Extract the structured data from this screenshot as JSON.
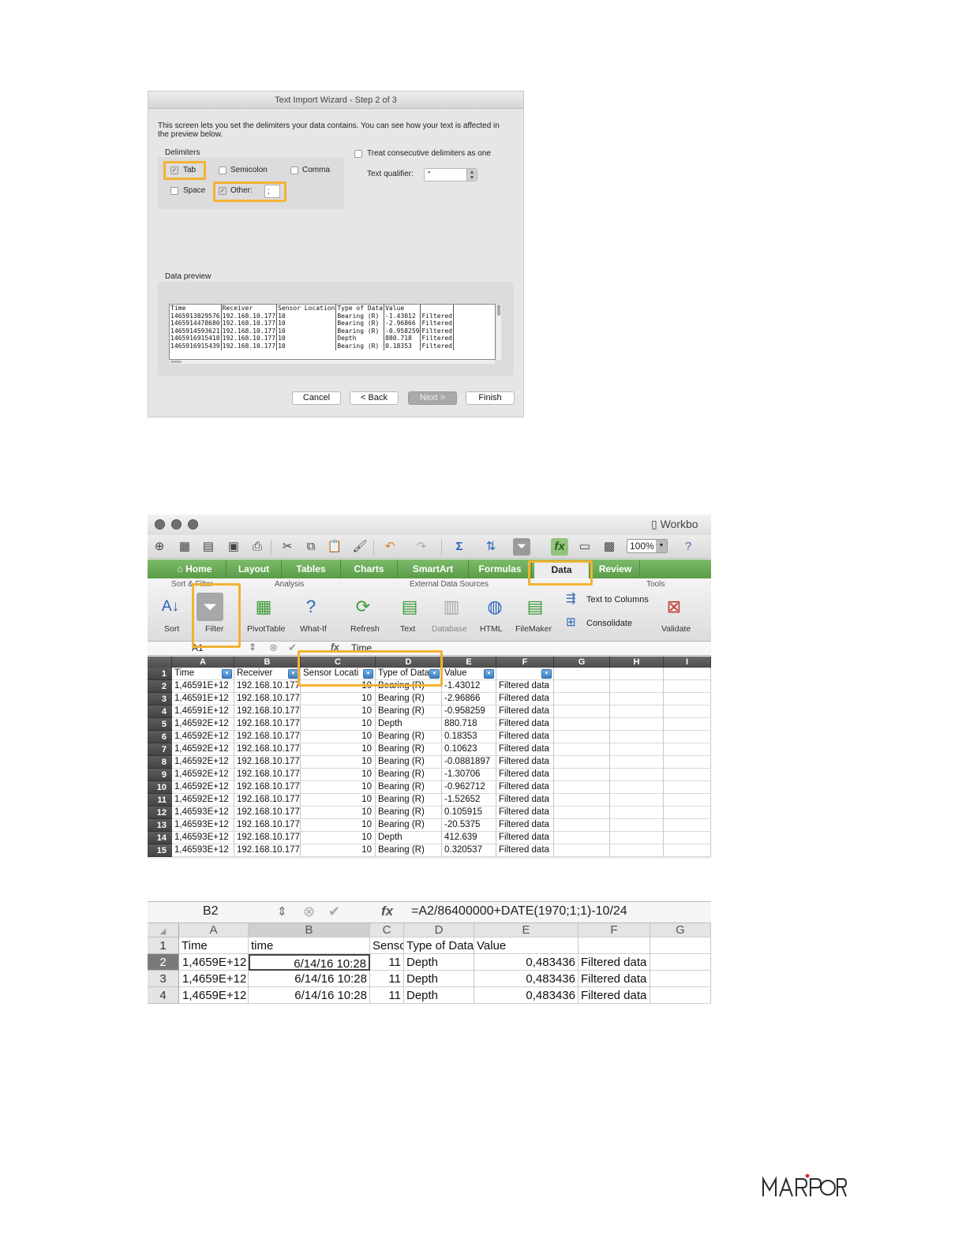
{
  "wizard": {
    "title": "Text Import Wizard - Step 2 of 3",
    "description": "This screen lets you set the delimiters your data contains.  You can see how your text is affected in the preview below.",
    "delimiters_label": "Delimiters",
    "tab_label": "Tab",
    "tab_checked": true,
    "semicolon_label": "Semicolon",
    "comma_label": "Comma",
    "space_label": "Space",
    "other_label": "Other:",
    "other_checked": true,
    "other_value": ";",
    "consecutive_label": "Treat consecutive delimiters as one",
    "qualifier_label": "Text qualifier:",
    "qualifier_value": "\"",
    "preview_label": "Data preview",
    "preview_headers": [
      "Time",
      "Receiver",
      "Sensor Location",
      "Type of Data",
      "Value",
      ""
    ],
    "preview_rows": [
      [
        "1465913829576",
        "192.168.10.177",
        "10",
        "Bearing (R)",
        "-1.43012",
        "Filtered"
      ],
      [
        "1465914478680",
        "192.168.10.177",
        "10",
        "Bearing (R)",
        "-2.96866",
        "Filtered"
      ],
      [
        "1465914593621",
        "192.168.10.177",
        "10",
        "Bearing (R)",
        "-0.958259",
        "Filtered"
      ],
      [
        "1465916915418",
        "192.168.10.177",
        "10",
        "Depth",
        "880.718",
        "Filtered"
      ],
      [
        "1465916915439",
        "192.168.10.177",
        "10",
        "Bearing (R)",
        "0.18353",
        "Filtered"
      ]
    ],
    "buttons": {
      "cancel": "Cancel",
      "back": "< Back",
      "next": "Next >",
      "finish": "Finish"
    }
  },
  "excel1": {
    "window_title": "Workbo",
    "zoom": "100%",
    "tabs": [
      "Home",
      "Layout",
      "Tables",
      "Charts",
      "SmartArt",
      "Formulas",
      "Data",
      "Review"
    ],
    "active_tab": "Data",
    "groups": {
      "sort_filter": "Sort & Filter",
      "analysis": "Analysis",
      "external": "External Data Sources",
      "tools": "Tools"
    },
    "buttons": {
      "sort": "Sort",
      "filter": "Filter",
      "pivottable": "PivotTable",
      "whatif": "What-If",
      "refresh": "Refresh",
      "text": "Text",
      "database": "Database",
      "html": "HTML",
      "filemaker": "FileMaker",
      "text_to_columns": "Text to Columns",
      "consolidate": "Consolidate",
      "validate": "Validate"
    },
    "name_box": "A1",
    "formula": "Time",
    "columns": [
      "A",
      "B",
      "C",
      "D",
      "E",
      "F",
      "G",
      "H",
      "I"
    ],
    "header_row": [
      "Time",
      "Receiver",
      "Sensor Locati",
      "Type of Data",
      "Value",
      ""
    ],
    "rows": [
      [
        "1,46591E+12",
        "192.168.10.177",
        "10",
        "Bearing (R)",
        "-1.43012",
        "Filtered data"
      ],
      [
        "1,46591E+12",
        "192.168.10.177",
        "10",
        "Bearing (R)",
        "-2.96866",
        "Filtered data"
      ],
      [
        "1,46591E+12",
        "192.168.10.177",
        "10",
        "Bearing (R)",
        "-0.958259",
        "Filtered data"
      ],
      [
        "1,46592E+12",
        "192.168.10.177",
        "10",
        "Depth",
        "880.718",
        "Filtered data"
      ],
      [
        "1,46592E+12",
        "192.168.10.177",
        "10",
        "Bearing (R)",
        "0.18353",
        "Filtered data"
      ],
      [
        "1,46592E+12",
        "192.168.10.177",
        "10",
        "Bearing (R)",
        "0.10623",
        "Filtered data"
      ],
      [
        "1,46592E+12",
        "192.168.10.177",
        "10",
        "Bearing (R)",
        "-0.0881897",
        "Filtered data"
      ],
      [
        "1,46592E+12",
        "192.168.10.177",
        "10",
        "Bearing (R)",
        "-1.30706",
        "Filtered data"
      ],
      [
        "1,46592E+12",
        "192.168.10.177",
        "10",
        "Bearing (R)",
        "-0.962712",
        "Filtered data"
      ],
      [
        "1,46592E+12",
        "192.168.10.177",
        "10",
        "Bearing (R)",
        "-1.52652",
        "Filtered data"
      ],
      [
        "1,46593E+12",
        "192.168.10.177",
        "10",
        "Bearing (R)",
        "0.105915",
        "Filtered data"
      ],
      [
        "1,46593E+12",
        "192.168.10.177",
        "10",
        "Bearing (R)",
        "-20.5375",
        "Filtered data"
      ],
      [
        "1,46593E+12",
        "192.168.10.177",
        "10",
        "Depth",
        "412.639",
        "Filtered data"
      ],
      [
        "1,46593E+12",
        "192.168.10.177",
        "10",
        "Bearing (R)",
        "0.320537",
        "Filtered data"
      ]
    ]
  },
  "excel2": {
    "name_box": "B2",
    "formula": "=A2/86400000+DATE(1970;1;1)-10/24",
    "columns": [
      "A",
      "B",
      "C",
      "D",
      "E",
      "F",
      "G"
    ],
    "header_row": [
      "Time",
      "time",
      "Sensor Locat",
      "Type of Data",
      "Value",
      ""
    ],
    "rows": [
      [
        "1,4659E+12",
        "6/14/16 10:28",
        "11",
        "Depth",
        "0,483436",
        "Filtered data"
      ],
      [
        "1,4659E+12",
        "6/14/16 10:28",
        "11",
        "Depth",
        "0,483436",
        "Filtered data"
      ],
      [
        "1,4659E+12",
        "6/14/16 10:28",
        "11",
        "Depth",
        "0,483436",
        "Filtered data"
      ]
    ]
  },
  "logo_text": "MARPORT",
  "colors": {
    "highlight": "#f2b233",
    "ribbon_green": "#5a9c48"
  }
}
